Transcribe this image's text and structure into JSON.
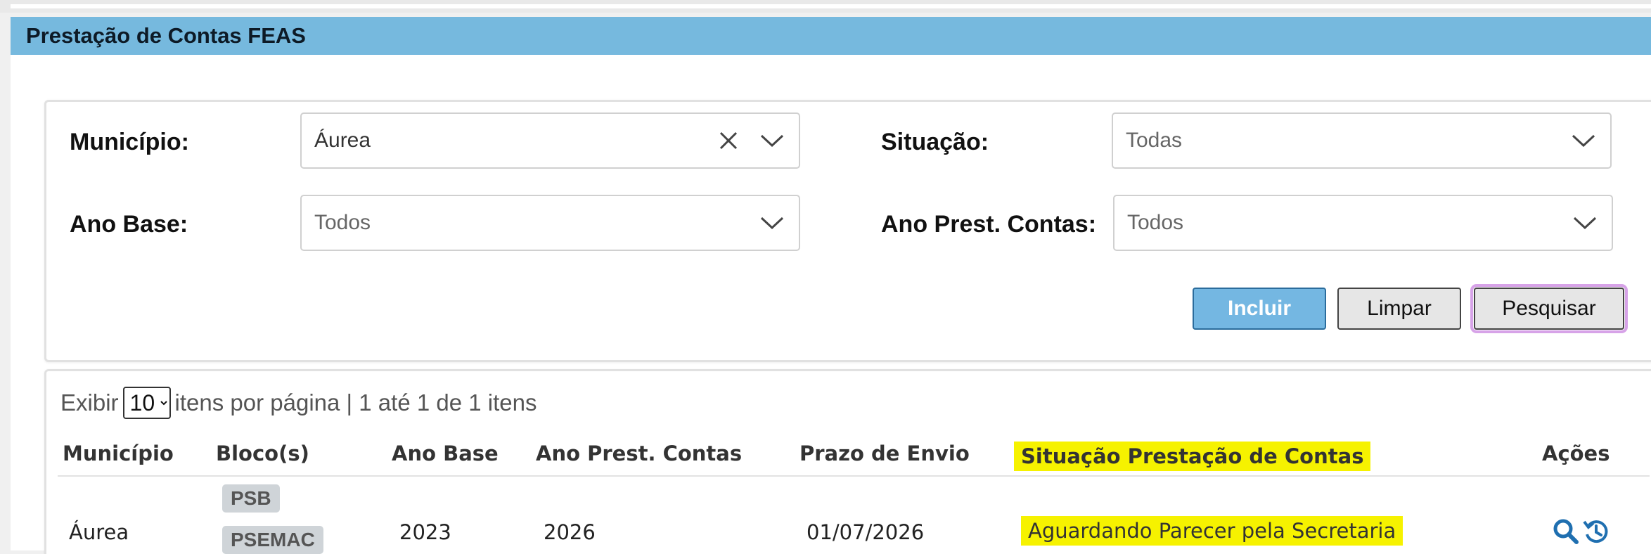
{
  "page": {
    "title": "Prestação de Contas FEAS"
  },
  "filters": {
    "municipio": {
      "label": "Município:",
      "value": "Áurea"
    },
    "situacao": {
      "label": "Situação:",
      "value": "Todas"
    },
    "ano_base": {
      "label": "Ano Base:",
      "value": "Todos"
    },
    "ano_prest_contas": {
      "label": "Ano Prest. Contas:",
      "value": "Todos"
    }
  },
  "buttons": {
    "incluir": "Incluir",
    "limpar": "Limpar",
    "pesquisar": "Pesquisar"
  },
  "pagination": {
    "prefix": "Exibir",
    "per_page": "10",
    "per_page_options": [
      "10"
    ],
    "suffix": "itens por página | 1 até 1 de 1 itens"
  },
  "table": {
    "columns": [
      "Município",
      "Bloco(s)",
      "Ano Base",
      "Ano Prest. Contas",
      "Prazo de Envio",
      "Situação Prestação de Contas",
      "Ações"
    ],
    "rows": [
      {
        "municipio": "Áurea",
        "blocos": [
          "PSB",
          "PSEMAC"
        ],
        "ano_base": "2023",
        "ano_prest_contas": "2026",
        "prazo_envio": "01/07/2026",
        "situacao": "Aguardando Parecer pela Secretaria",
        "acoes": [
          "search-icon",
          "history-icon"
        ]
      }
    ]
  },
  "colors": {
    "header_bg": "#76b9de",
    "primary_button": "#74b7e2",
    "highlight": "#f6f200",
    "action_icon": "#1f6fb0"
  }
}
